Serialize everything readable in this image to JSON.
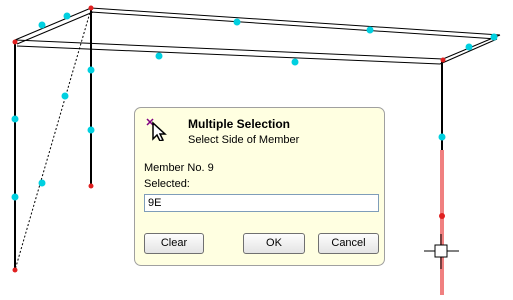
{
  "dialog": {
    "title": "Multiple Selection",
    "subtitle": "Select Side of Member",
    "member_label": "Member No. 9",
    "selected_label": "Selected:",
    "selected_value": "9E",
    "buttons": {
      "clear": "Clear",
      "ok": "OK",
      "cancel": "Cancel"
    }
  },
  "colors": {
    "node": "#00d0e0",
    "end_node": "#e02020",
    "highlight": "#f08080",
    "member_line": "#000000",
    "dialog_bg": "#ffffe1"
  },
  "icons": {
    "dialog_icon": "select-pointer-icon",
    "cursor": "crosshair-select-icon"
  }
}
